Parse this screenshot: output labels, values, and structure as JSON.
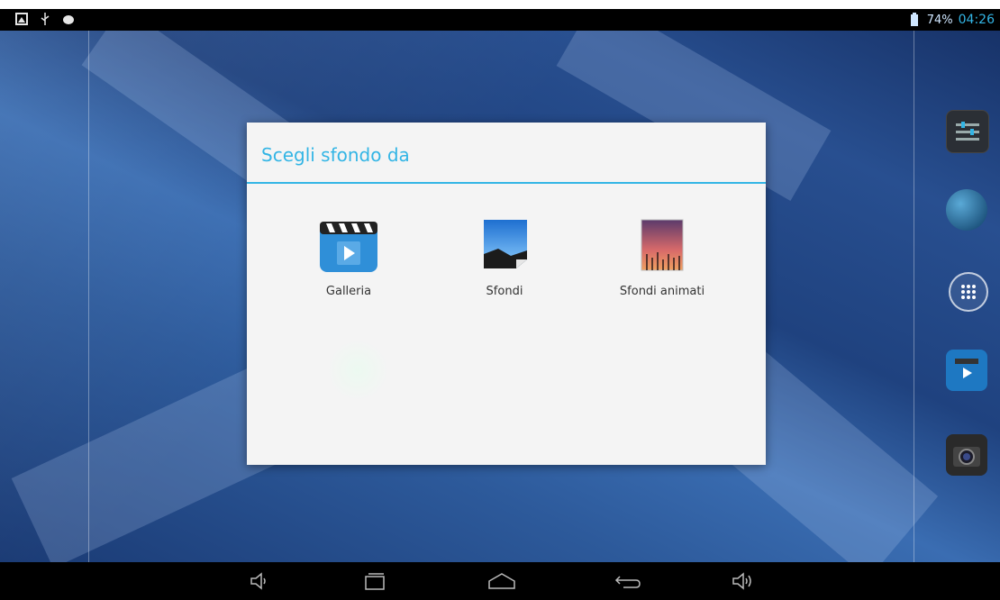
{
  "status_bar": {
    "battery": "74%",
    "time": "04:26",
    "left_icons": [
      "screenshot-icon",
      "usb-icon",
      "android-debug-icon"
    ]
  },
  "dialog": {
    "title": "Scegli sfondo da",
    "options": [
      {
        "label": "Galleria",
        "icon": "gallery-icon"
      },
      {
        "label": "Sfondi",
        "icon": "wallpapers-icon"
      },
      {
        "label": "Sfondi animati",
        "icon": "live-wallpapers-icon"
      }
    ]
  },
  "dock": {
    "items": [
      "settings-icon",
      "globe-icon",
      "all-apps-icon",
      "video-icon",
      "camera-icon"
    ]
  },
  "nav_bar": {
    "buttons": [
      "volume-down-icon",
      "recent-apps-icon",
      "home-icon",
      "back-icon",
      "volume-up-icon"
    ]
  },
  "colors": {
    "accent": "#33b5e5",
    "dialog_bg": "#f4f4f4",
    "bar_bg": "#000000"
  }
}
